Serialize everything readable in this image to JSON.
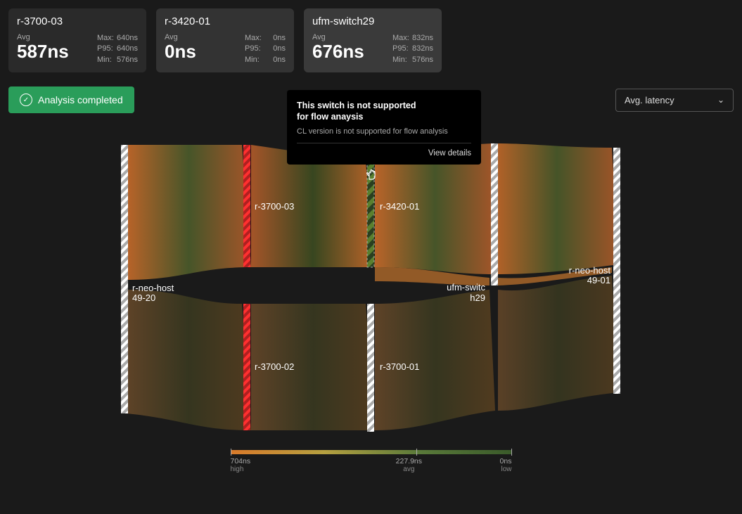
{
  "cards": [
    {
      "title": "r-3700-03",
      "avg_label": "Avg",
      "avg_value": "587ns",
      "max_label": "Max:",
      "max_value": "640ns",
      "p95_label": "P95:",
      "p95_value": "640ns",
      "min_label": "Min:",
      "min_value": "576ns"
    },
    {
      "title": "r-3420-01",
      "avg_label": "Avg",
      "avg_value": "0ns",
      "max_label": "Max:",
      "max_value": "0ns",
      "p95_label": "P95:",
      "p95_value": "0ns",
      "min_label": "Min:",
      "min_value": "0ns"
    },
    {
      "title": "ufm-switch29",
      "avg_label": "Avg",
      "avg_value": "676ns",
      "max_label": "Max:",
      "max_value": "832ns",
      "p95_label": "P95:",
      "p95_value": "832ns",
      "min_label": "Min:",
      "min_value": "576ns"
    }
  ],
  "status": {
    "text": "Analysis completed"
  },
  "dropdown": {
    "label": "Avg. latency"
  },
  "tooltip": {
    "title_line1": "This switch is not supported",
    "title_line2": "for flow anaysis",
    "subtitle": "CL version is not supported for flow analysis",
    "link": "View details"
  },
  "nodes": {
    "r_neo_host_49_20_l1": "r-neo-host",
    "r_neo_host_49_20_l2": "49-20",
    "r_3700_03": "r-3700-03",
    "r_3700_02": "r-3700-02",
    "r_3420_01": "r-3420-01",
    "r_3700_01": "r-3700-01",
    "ufm_switch29_l1": "ufm-switc",
    "ufm_switch29_l2": "h29",
    "r_neo_host_49_01_l1": "r-neo-host",
    "r_neo_host_49_01_l2": "49-01"
  },
  "legend": {
    "high_value": "704ns",
    "high_label": "high",
    "avg_value": "227.9ns",
    "avg_label": "avg",
    "low_value": "0ns",
    "low_label": "low"
  }
}
